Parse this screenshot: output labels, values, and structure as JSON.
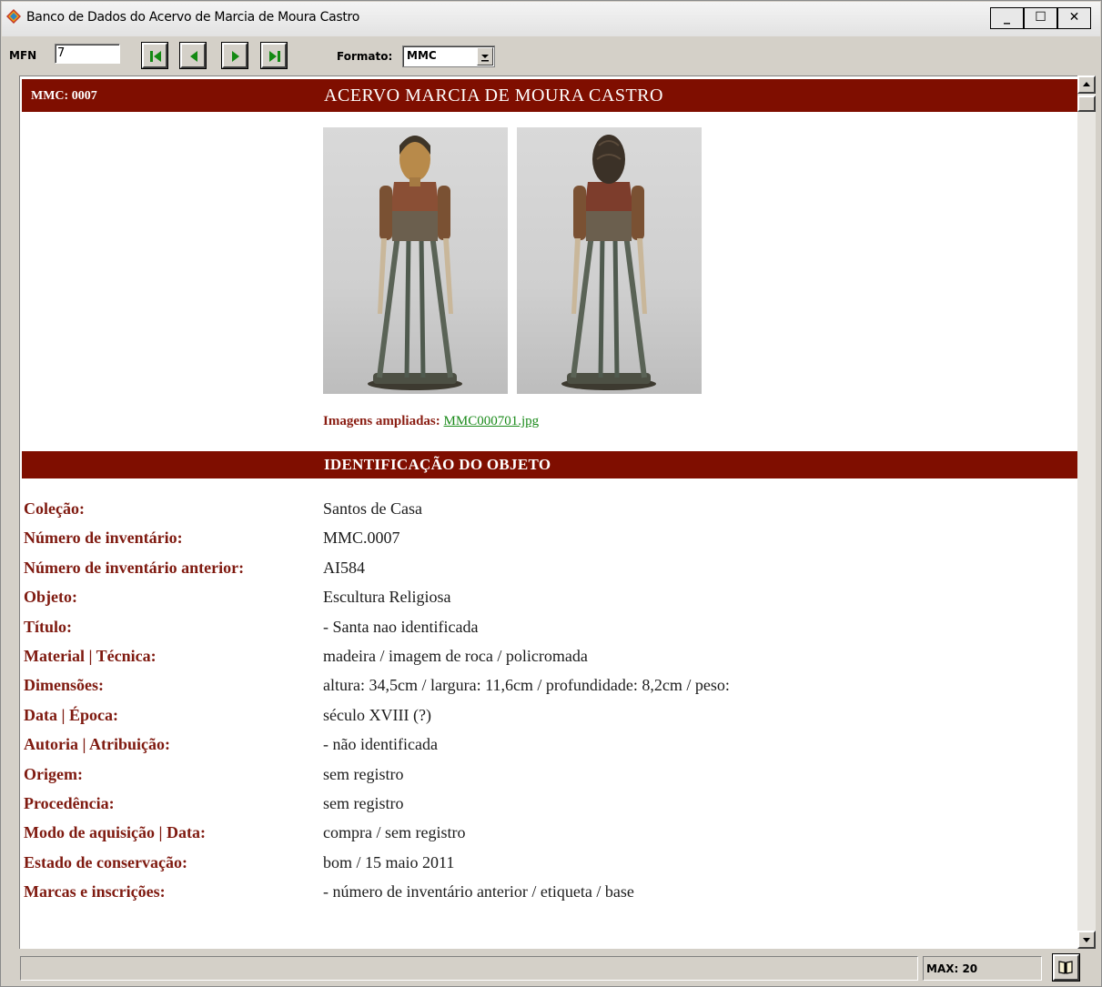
{
  "window": {
    "title": "Banco de Dados do Acervo de Marcia de Moura Castro",
    "minimize": "_",
    "maximize": "☐",
    "close": "✕"
  },
  "toolbar": {
    "mfn_label": "MFN",
    "mfn_value": "7",
    "nav": [
      "first-record",
      "previous-record",
      "next-record",
      "last-record"
    ],
    "format_label": "Formato:",
    "format_value": "MMC"
  },
  "record": {
    "id": "MMC: 0007",
    "header_title": "ACERVO MARCIA DE MOURA CASTRO",
    "images_label": "Imagens ampliadas:",
    "images_file": "MMC000701.jpg",
    "section_title": "IDENTIFICAÇÃO DO OBJETO",
    "fields": [
      {
        "label": "Coleção:",
        "value": "Santos de Casa"
      },
      {
        "label": "Número de inventário:",
        "value": "MMC.0007"
      },
      {
        "label": "Número de inventário anterior:",
        "value": "AI584"
      },
      {
        "label": "Objeto:",
        "value": "Escultura Religiosa"
      },
      {
        "label": "Título:",
        "value": "- Santa nao identificada"
      },
      {
        "label": "Material | Técnica:",
        "value": "madeira / imagem de roca / policromada"
      },
      {
        "label": "Dimensões:",
        "value": "altura: 34,5cm  /  largura: 11,6cm  /  profundidade: 8,2cm  /  peso:"
      },
      {
        "label": "Data | Época:",
        "value": "século XVIII (?)"
      },
      {
        "label": "Autoria | Atribuição:",
        "value": "- não identificada"
      },
      {
        "label": "Origem:",
        "value": "sem registro"
      },
      {
        "label": "Procedência:",
        "value": "sem registro"
      },
      {
        "label": "Modo de aquisição | Data:",
        "value": "compra / sem registro"
      },
      {
        "label": "Estado de conservação:",
        "value": "bom / 15 maio 2011"
      },
      {
        "label": "Marcas e inscrições:",
        "value": "- número de inventário anterior / etiqueta / base"
      }
    ]
  },
  "status": {
    "message": "",
    "max": "MAX: 20"
  },
  "colors": {
    "header_bar": "#7f0e00",
    "label_text": "#7f1a10",
    "link_green": "#1a8a1a",
    "nav_arrow": "#138a13"
  }
}
